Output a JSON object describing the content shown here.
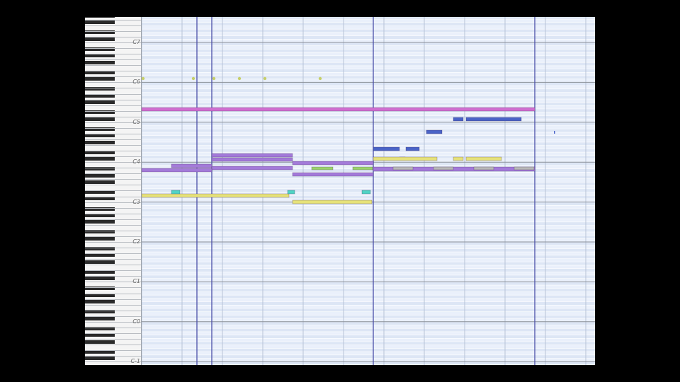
{
  "keyboard": {
    "octave_labels": [
      {
        "name": "C7",
        "row": 0
      },
      {
        "name": "C6",
        "row": 12
      },
      {
        "name": "C5",
        "row": 24
      },
      {
        "name": "C4",
        "row": 36
      },
      {
        "name": "C3",
        "row": 48
      },
      {
        "name": "C2",
        "row": 60
      },
      {
        "name": "C1",
        "row": 72
      },
      {
        "name": "C0",
        "row": 84
      },
      {
        "name": "C-1",
        "row": 96
      }
    ]
  },
  "colors": {
    "background": "#eaf0fb",
    "lane_dark": "#dde6f5",
    "beat_line": "#b8c3d6",
    "measure_line": "#4b4fa8",
    "octave_line": "#8a8f98",
    "magenta": "#d06ed0",
    "purple": "#a37ad9",
    "blue": "#4a63c7",
    "yellow": "#e6e27a",
    "green": "#9bd36b",
    "cyan": "#4fd3c4",
    "gray": "#b8b8b8"
  }
}
